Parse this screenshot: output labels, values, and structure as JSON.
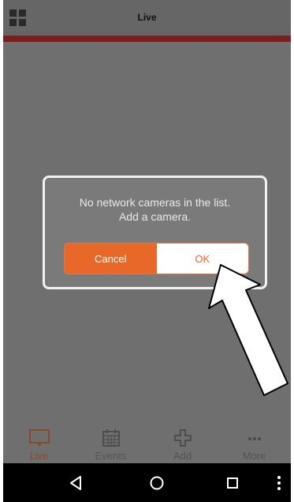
{
  "header": {
    "title": "Live",
    "accent_color": "#7b1e1e"
  },
  "dialog": {
    "message_line1": "No network cameras in the list.",
    "message_line2": "Add a camera.",
    "cancel_label": "Cancel",
    "ok_label": "OK",
    "accent_color": "#e8682a"
  },
  "tabbar": {
    "items": [
      {
        "label": "Live",
        "icon": "monitor-icon",
        "active": true
      },
      {
        "label": "Events",
        "icon": "calendar-icon",
        "active": false
      },
      {
        "label": "Add",
        "icon": "plus-icon",
        "active": false
      },
      {
        "label": "More",
        "icon": "more-dots-icon",
        "active": false
      }
    ]
  },
  "android_nav": {
    "buttons": [
      "back-icon",
      "home-icon",
      "recents-icon",
      "overflow-menu-icon"
    ]
  }
}
